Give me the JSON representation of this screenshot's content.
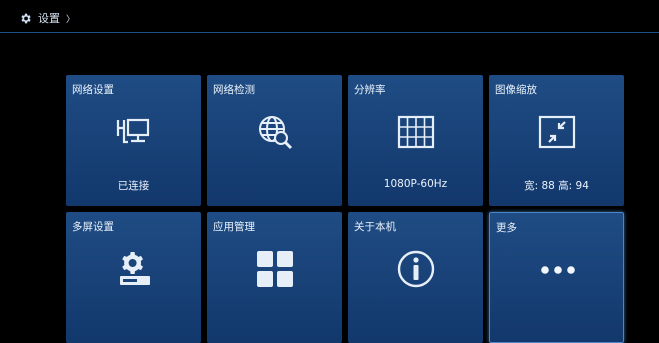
{
  "header": {
    "title": "设置",
    "chevron": "〉",
    "icon": "gear-icon"
  },
  "tiles": [
    {
      "title": "网络设置",
      "status": "已连接",
      "icon": "network-icon"
    },
    {
      "title": "网络检测",
      "status": "",
      "icon": "globe-search-icon"
    },
    {
      "title": "分辨率",
      "status": "1080P-60Hz",
      "icon": "grid-screen-icon"
    },
    {
      "title": "图像缩放",
      "status": "宽: 88 高: 94",
      "icon": "shrink-icon"
    },
    {
      "title": "多屏设置",
      "status": "",
      "icon": "multiscreen-gear-icon"
    },
    {
      "title": "应用管理",
      "status": "",
      "icon": "apps-icon"
    },
    {
      "title": "关于本机",
      "status": "",
      "icon": "info-icon"
    },
    {
      "title": "更多",
      "status": "",
      "icon": "more-dots-icon"
    }
  ],
  "colors": {
    "accent": "#1e4f86",
    "tile_top": "#1f4c84",
    "tile_bottom": "#12386c",
    "selected_border": "#4a86c8"
  }
}
